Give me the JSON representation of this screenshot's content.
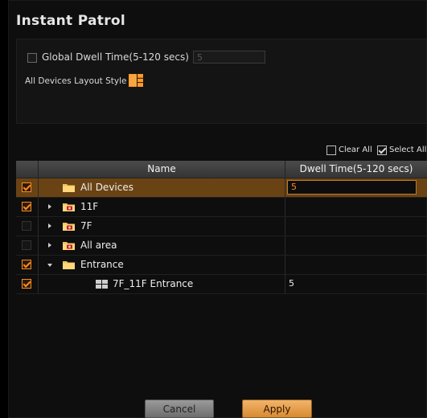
{
  "dialog": {
    "title": "Instant Patrol",
    "global_dwell": {
      "label": "Global Dwell Time(5-120 secs)",
      "checked": false,
      "placeholder": "5"
    },
    "layout_style": {
      "label": "All Devices Layout Style",
      "icon": "layout-grid-icon"
    }
  },
  "toolbar": {
    "clear_all": "Clear All",
    "select_all": "Select All"
  },
  "table": {
    "columns": [
      "Name",
      "Dwell Time(5-120 secs)"
    ],
    "rows": [
      {
        "name": "All Devices",
        "checked": true,
        "dwell": "5",
        "expander": "none",
        "icon": "folder-icon",
        "selected": true
      },
      {
        "name": "11F",
        "checked": true,
        "dwell": "",
        "expander": "collapsed",
        "icon": "folder-camera-icon"
      },
      {
        "name": "7F",
        "checked": false,
        "dwell": "",
        "expander": "collapsed",
        "icon": "folder-camera-icon"
      },
      {
        "name": "All area",
        "checked": false,
        "dwell": "",
        "expander": "collapsed",
        "icon": "folder-camera-icon"
      },
      {
        "name": "Entrance",
        "checked": true,
        "dwell": "",
        "expander": "expanded",
        "icon": "folder-icon"
      },
      {
        "name": "7F_11F Entrance",
        "checked": true,
        "dwell": "5",
        "expander": "none",
        "icon": "layout-grid-icon"
      }
    ]
  },
  "buttons": {
    "cancel": "Cancel",
    "apply": "Apply"
  },
  "colors": {
    "accent": "#ff8a1e",
    "selected_row": "#6a4314",
    "background": "#0e0e0e"
  }
}
